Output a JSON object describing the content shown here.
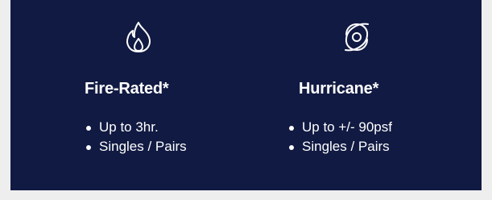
{
  "features": [
    {
      "icon": "flame-icon",
      "title": "Fire-Rated*",
      "bullets": [
        "Up to 3hr.",
        "Singles / Pairs"
      ]
    },
    {
      "icon": "hurricane-icon",
      "title": "Hurricane*",
      "bullets": [
        "Up to +/- 90psf",
        "Singles / Pairs"
      ]
    }
  ],
  "colors": {
    "panel_background": "#111a42",
    "page_background": "#eeeeee",
    "text": "#ffffff"
  }
}
